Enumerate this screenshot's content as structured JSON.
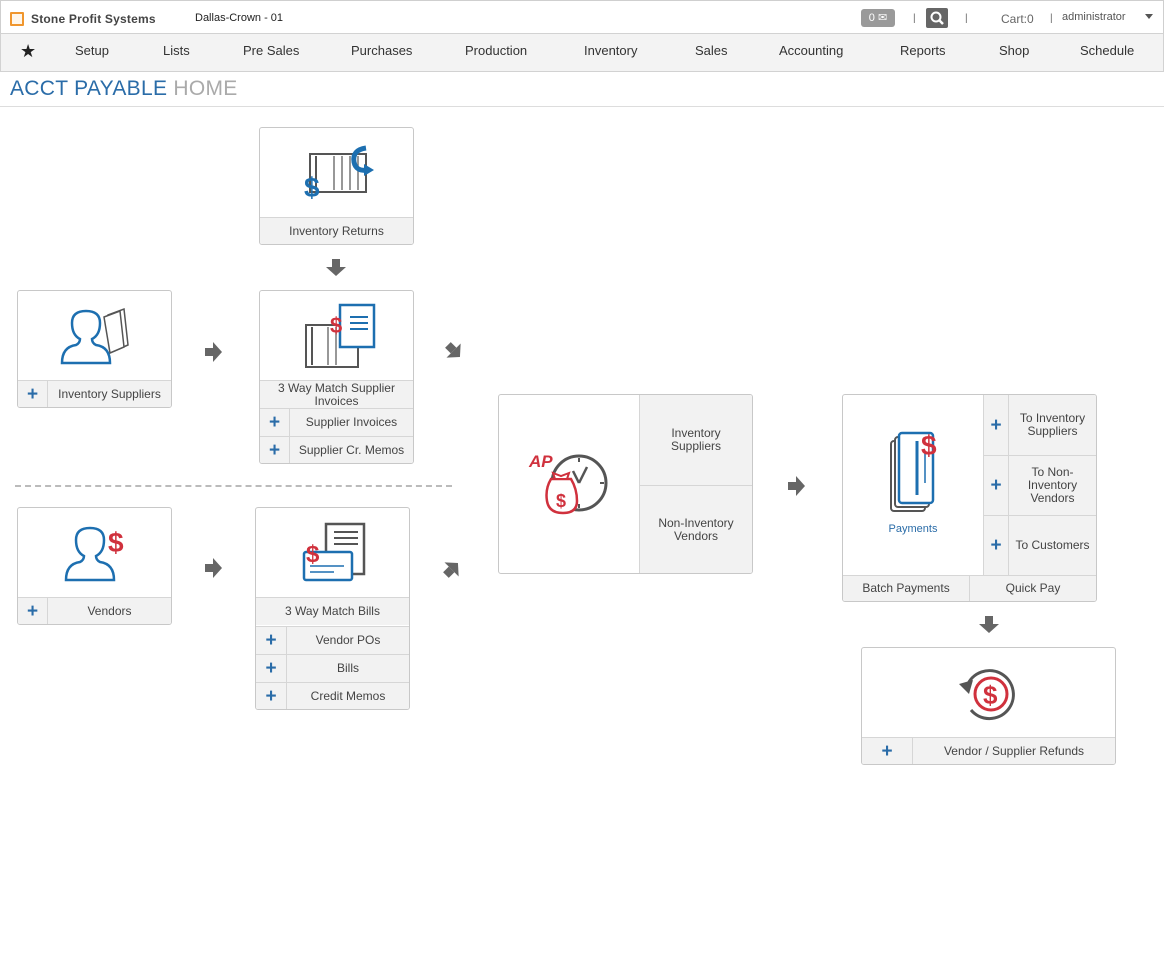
{
  "header": {
    "brand": "Stone Profit Systems",
    "location": "Dallas-Crown - 01",
    "messages_count": "0",
    "separator": "|",
    "cart": "Cart:0",
    "user": "administrator"
  },
  "nav": {
    "star": "★",
    "items": [
      "Setup",
      "Lists",
      "Pre Sales",
      "Purchases",
      "Production",
      "Inventory",
      "Sales",
      "Accounting",
      "Reports",
      "Shop",
      "Schedule"
    ]
  },
  "page": {
    "title_primary": "ACCT PAYABLE",
    "title_secondary": "HOME"
  },
  "plus": "+",
  "inventory_returns": {
    "label": "Inventory Returns"
  },
  "inventory_suppliers": {
    "label": "Inventory Suppliers"
  },
  "three_way_supplier": {
    "title": "3 Way Match Supplier Invoices",
    "rows": [
      "Supplier Invoices",
      "Supplier Cr. Memos"
    ]
  },
  "vendors": {
    "label": "Vendors"
  },
  "three_way_bills": {
    "title": "3 Way Match Bills",
    "rows": [
      "Vendor POs",
      "Bills",
      "Credit Memos"
    ]
  },
  "ap_aging": {
    "inventory_suppliers": "Inventory Suppliers",
    "non_inventory_vendors": "Non-Inventory Vendors"
  },
  "payments": {
    "label": "Payments",
    "to_inventory_suppliers": "To Inventory Suppliers",
    "to_non_inventory_vendors": "To Non-Inventory Vendors",
    "to_customers": "To Customers",
    "batch_payments": "Batch Payments",
    "quick_pay": "Quick Pay"
  },
  "refunds": {
    "label": "Vendor / Supplier Refunds"
  },
  "colors": {
    "accent_blue": "#2a6ca8",
    "accent_red": "#d0313d",
    "orange": "#f0962d"
  }
}
